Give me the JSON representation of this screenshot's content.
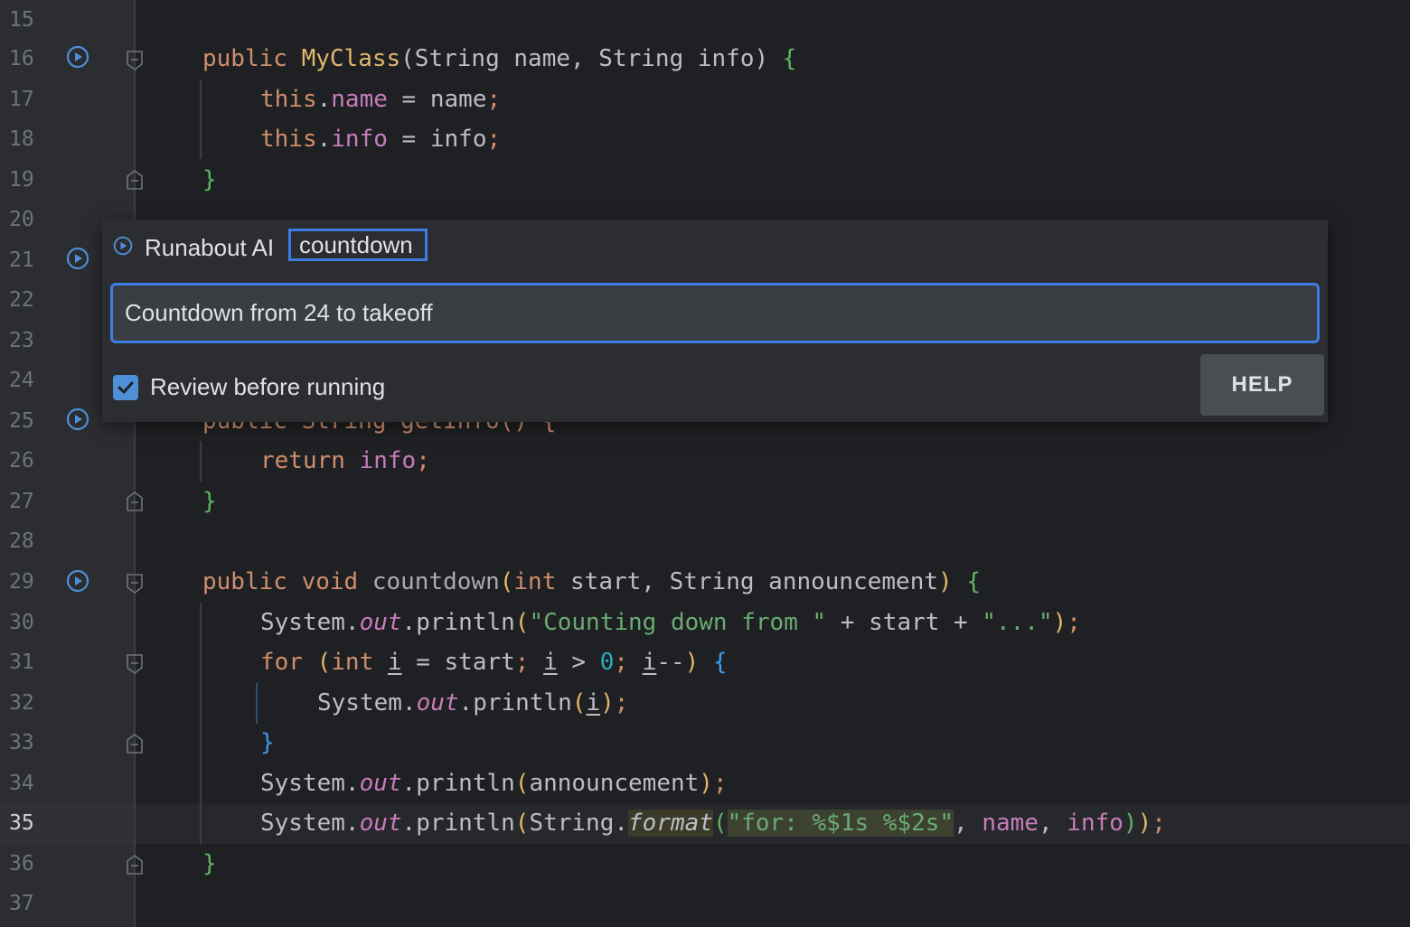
{
  "editor": {
    "line_numbers": [
      "15",
      "16",
      "17",
      "18",
      "19",
      "20",
      "21",
      "22",
      "23",
      "24",
      "25",
      "26",
      "27",
      "28",
      "29",
      "30",
      "31",
      "32",
      "33",
      "34",
      "35",
      "36",
      "37"
    ],
    "current_line": "35",
    "code": {
      "l16": {
        "t1": "public ",
        "t2": "MyClass",
        "t3": "(String name, String info) ",
        "t4": "{"
      },
      "l17": {
        "t1": "this",
        "t2": ".",
        "t3": "name",
        "t4": " = name",
        "t5": ";"
      },
      "l18": {
        "t1": "this",
        "t2": ".",
        "t3": "info",
        "t4": " = info",
        "t5": ";"
      },
      "l19": {
        "t1": "}"
      },
      "l25_hidden": "public String getInfo() {",
      "l26": {
        "t1": "return ",
        "t2": "info",
        "t3": ";"
      },
      "l27": {
        "t1": "}"
      },
      "l29": {
        "t1": "public void ",
        "t2": "countdown",
        "t3": "(",
        "t4": "int",
        "t5": " start, String announcement",
        "t6": ") ",
        "t7": "{"
      },
      "l30": {
        "t1": "System.",
        "t2": "out",
        "t3": ".println",
        "t4": "(",
        "t5": "\"Counting down from \"",
        "t6": " + start + ",
        "t7": "\"...\"",
        "t8": ")",
        "t9": ";"
      },
      "l31": {
        "t1": "for ",
        "t2": "(",
        "t3": "int ",
        "t4": "i",
        "t5": " = start",
        "t6": "; ",
        "t7": "i",
        "t8": " > ",
        "t9": "0",
        "t10": "; ",
        "t11": "i",
        "t12": "--",
        "t13": ") ",
        "t14": "{"
      },
      "l32": {
        "t1": "System.",
        "t2": "out",
        "t3": ".println",
        "t4": "(",
        "t5": "i",
        "t6": ")",
        "t7": ";"
      },
      "l33": {
        "t1": "}"
      },
      "l34": {
        "t1": "System.",
        "t2": "out",
        "t3": ".println",
        "t4": "(",
        "t5": "announcement",
        "t6": ")",
        "t7": ";"
      },
      "l35": {
        "t1": "System.",
        "t2": "out",
        "t3": ".println",
        "t4": "(",
        "t5": "String.",
        "t6": "format",
        "t7": "(",
        "t8": "\"for: %$1s %$2s\"",
        "t9": ", ",
        "t10": "name",
        "t11": ", ",
        "t12": "info",
        "t13": ")",
        "t14": ")",
        "t15": ";"
      },
      "l36": {
        "t1": "}"
      }
    }
  },
  "popup": {
    "title": "Runabout AI",
    "tag": "countdown",
    "input_value": "Countdown from 24 to takeoff",
    "checkbox_label": "Review before running",
    "checkbox_checked": true,
    "help_label": "HELP"
  },
  "colors": {
    "accent": "#3d7de3",
    "keyword": "#cf8e6d",
    "string": "#6aab73",
    "field": "#c77dbb",
    "function": "#e2b66b"
  },
  "icons": [
    "run-gutter-icon",
    "fold-marker-icon",
    "checkbox-check-icon"
  ]
}
